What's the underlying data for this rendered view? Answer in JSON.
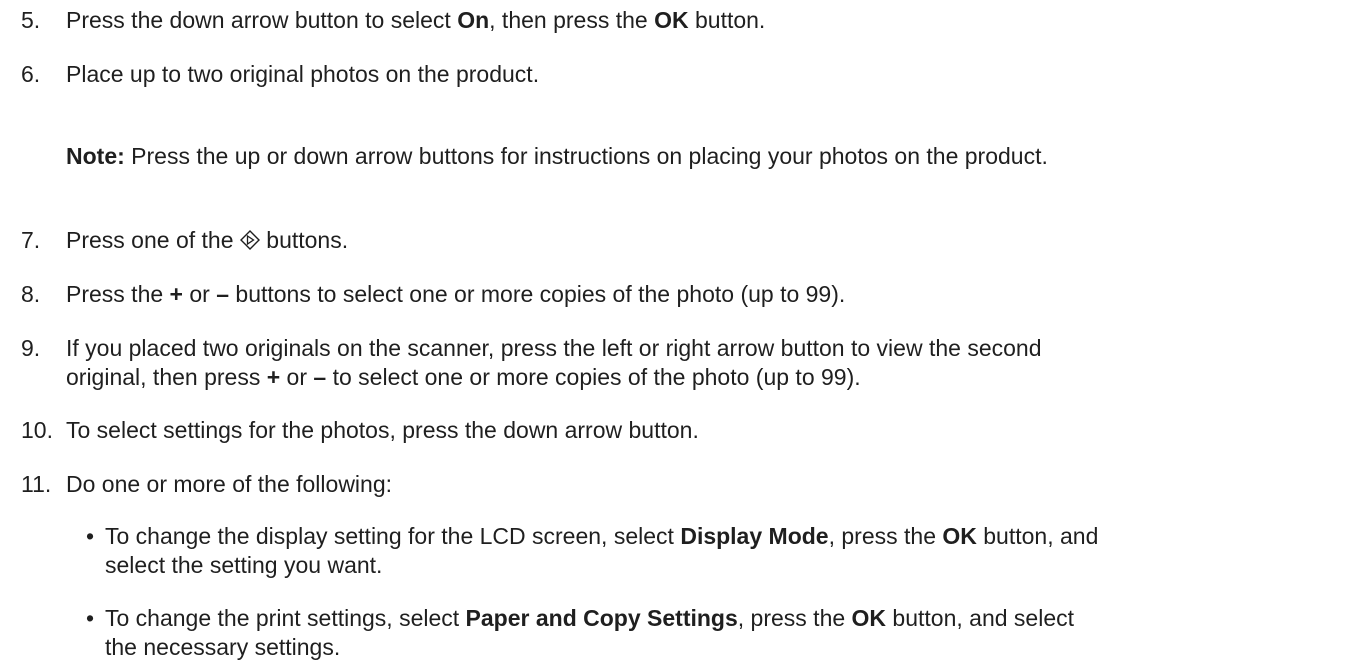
{
  "steps": [
    {
      "num": "5.",
      "parts": [
        "Press the down arrow button to select ",
        "On",
        ", then press the ",
        "OK",
        " button."
      ]
    },
    {
      "num": "6.",
      "text": "Place up to two original photos on the product."
    },
    {
      "note_label": "Note:",
      "note_text": " Press the up or down arrow buttons for instructions on placing your photos on the product."
    },
    {
      "num": "7.",
      "before": "Press one of the ",
      "after": " buttons.",
      "icon": "start-button-icon"
    },
    {
      "num": "8.",
      "parts": [
        "Press the ",
        "+",
        " or ",
        "–",
        " buttons to select one or more copies of the photo (up to 99)."
      ]
    },
    {
      "num": "9.",
      "line1": "If you placed two originals on the scanner, press the left or right arrow button to view the second",
      "line2_parts": [
        "original, then press ",
        "+",
        " or ",
        "–",
        " to select one or more copies of the photo (up to 99)."
      ]
    },
    {
      "num": "10.",
      "text": "To select settings for the photos, press the down arrow button."
    },
    {
      "num": "11.",
      "text": "Do one or more of the following:"
    }
  ],
  "bullets": [
    {
      "line1_parts": [
        "To change the display setting for the LCD screen, select ",
        "Display Mode",
        ", press the ",
        "OK",
        " button, and"
      ],
      "line2": "select the setting you want."
    },
    {
      "line1_parts": [
        "To change the print settings, select ",
        "Paper and Copy Settings",
        ", press the ",
        "OK",
        " button, and select"
      ],
      "line2": "the necessary settings."
    }
  ],
  "bullet_glyph": "•"
}
